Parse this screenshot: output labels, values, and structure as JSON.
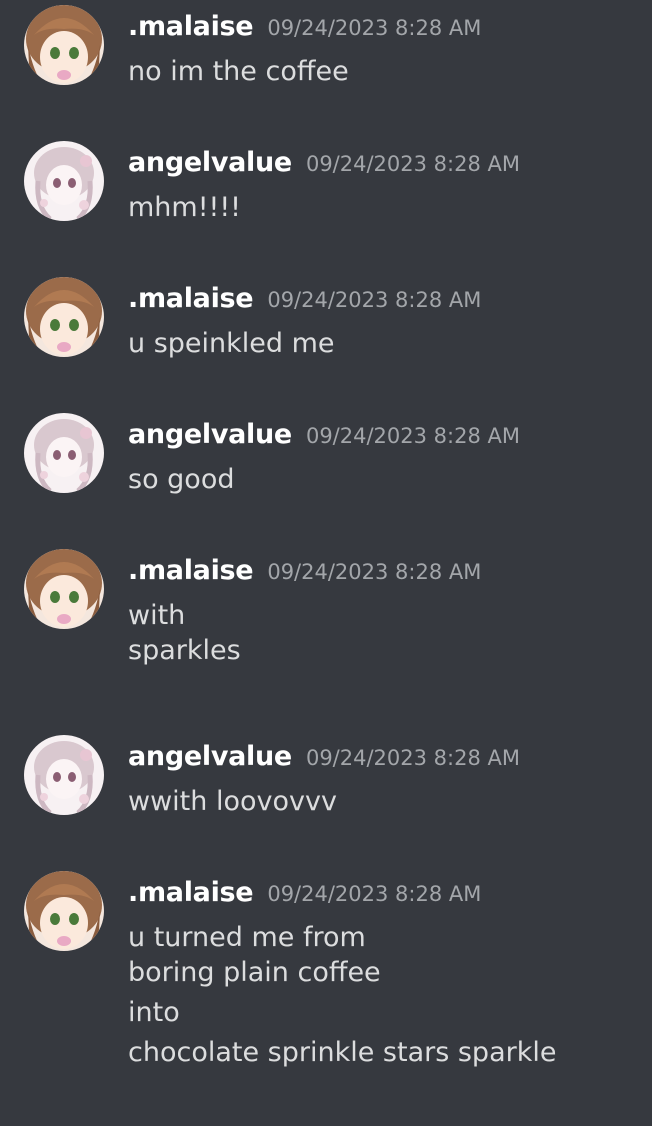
{
  "messages": [
    {
      "author": ".malaise",
      "avatar": "malaise-avatar",
      "timestamp": "09/24/2023 8:28 AM",
      "lines": [
        "no im the coffee"
      ]
    },
    {
      "author": "angelvalue",
      "avatar": "angelvalue-avatar",
      "timestamp": "09/24/2023 8:28 AM",
      "lines": [
        "mhm!!!!"
      ]
    },
    {
      "author": ".malaise",
      "avatar": "malaise-avatar",
      "timestamp": "09/24/2023 8:28 AM",
      "lines": [
        "u speinkled me"
      ]
    },
    {
      "author": "angelvalue",
      "avatar": "angelvalue-avatar",
      "timestamp": "09/24/2023 8:28 AM",
      "lines": [
        "so good"
      ]
    },
    {
      "author": ".malaise",
      "avatar": "malaise-avatar",
      "timestamp": "09/24/2023 8:28 AM",
      "lines": [
        "with",
        "sparkles"
      ]
    },
    {
      "author": "angelvalue",
      "avatar": "angelvalue-avatar",
      "timestamp": "09/24/2023 8:28 AM",
      "lines": [
        "wwith loovovvv"
      ]
    },
    {
      "author": ".malaise",
      "avatar": "malaise-avatar",
      "timestamp": "09/24/2023 8:28 AM",
      "lines": [
        "u turned me from",
        "boring plain coffee",
        "into",
        "chocolate sprinkle stars sparkle"
      ]
    }
  ],
  "colors": {
    "background": "#36393f",
    "username": "#ffffff",
    "timestamp": "#a3a6aa",
    "text": "#dcddde"
  }
}
